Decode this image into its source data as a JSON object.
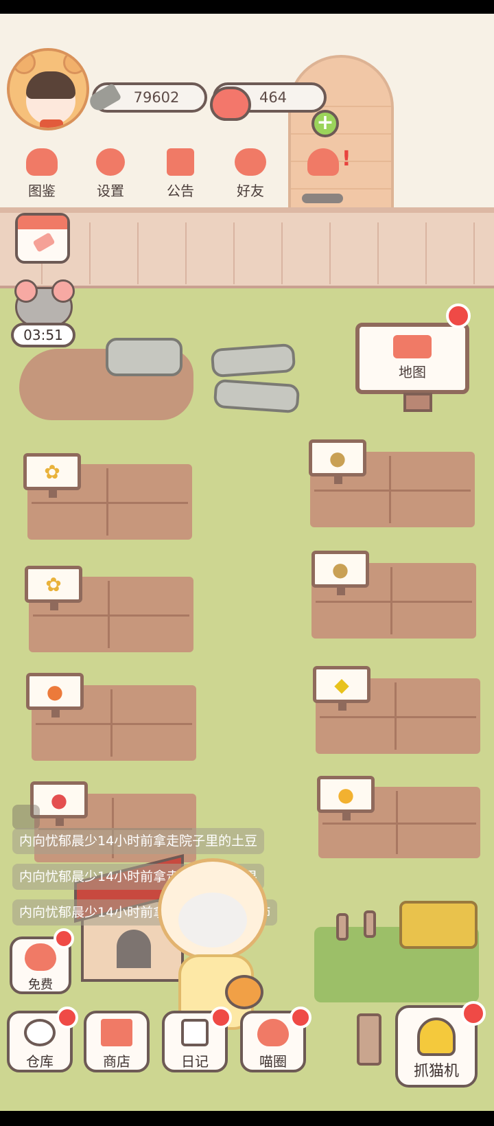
{
  "currency": {
    "fish": "79602",
    "hearts": "464"
  },
  "menu": [
    {
      "label": "图鉴",
      "icon": "cat-book-icon"
    },
    {
      "label": "设置",
      "icon": "gear-icon"
    },
    {
      "label": "公告",
      "icon": "gift-icon"
    },
    {
      "label": "好友",
      "icon": "friends-icon"
    }
  ],
  "event_timer": "03:51",
  "map_sign": {
    "label": "地图"
  },
  "notices": [
    "内向忧郁晨少14小时前拿走院子里的土豆",
    "内向忧郁晨少14小时前拿走院子里的芒果",
    "内向忧郁晨少14小时前拿走院子里的西红柿"
  ],
  "fields": {
    "left": [
      "wheat",
      "wheat",
      "carrot",
      "tomato"
    ],
    "right": [
      "potato",
      "potato",
      "corn",
      "mango"
    ]
  },
  "bottom_buttons": {
    "free": "免费",
    "warehouse": "仓库",
    "shop": "商店",
    "diary": "日记",
    "circle": "喵圈",
    "claw": "抓猫机"
  },
  "colors": {
    "accent": "#f07a66",
    "alert": "#ef4a46",
    "grass": "#cdd691"
  }
}
